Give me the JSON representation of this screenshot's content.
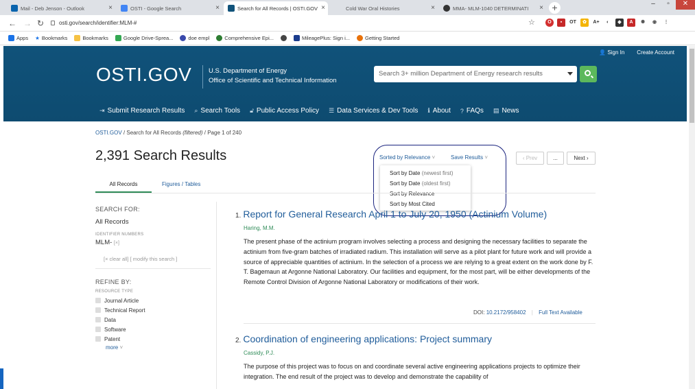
{
  "browser": {
    "tabs": [
      {
        "title": "Mail - Deb Jenson - Outlook",
        "color": "#0a64ad"
      },
      {
        "title": "OSTI - Google Search",
        "color": "#4285f4"
      },
      {
        "title": "Search for All Records | OSTI.GOV",
        "color": "#10527a"
      },
      {
        "title": "Cold War Oral Histories",
        "color": "#888888"
      },
      {
        "title": "MMA- MLM-1040 DETERMINATI",
        "color": "#333333"
      }
    ],
    "url": "osti.gov/search/identifier:MLM-#",
    "bookmarks": [
      "Apps",
      "Bookmarks",
      "Bookmarks",
      "Google Drive-Sprea...",
      "doe empl",
      "Comprehensive Epi...",
      "MileagePlus: Sign i...",
      "Getting Started"
    ]
  },
  "site": {
    "sign_in": "Sign In",
    "create_account": "Create Account",
    "logo": "OSTI.GOV",
    "doe_line1": "U.S. Department of Energy",
    "doe_line2": "Office of Scientific and Technical Information",
    "search_placeholder": "Search 3+ million Department of Energy research results",
    "nav": [
      "Submit Research Results",
      "Search Tools",
      "Public Access Policy",
      "Data Services & Dev Tools",
      "About",
      "FAQs",
      "News"
    ]
  },
  "page": {
    "crumb_home": "OSTI.GOV",
    "crumb_search": "Search for All Records",
    "crumb_filtered": "(filtered)",
    "crumb_page": "Page 1 of 240",
    "results_count": "2,391 Search Results",
    "sorted_by": "Sorted by Relevance",
    "save_results": "Save Results",
    "sort_options": [
      {
        "main": "Sort by Date",
        "sub": "(newest first)"
      },
      {
        "main": "Sort by Date",
        "sub": "(oldest first)"
      },
      {
        "main": "Sort by Relevance",
        "sub": ""
      },
      {
        "main": "Sort by Most Cited",
        "sub": ""
      }
    ],
    "pager": {
      "prev": "‹ Prev",
      "ellipsis": "...",
      "next": "Next ›"
    },
    "tabs": [
      "All Records",
      "Figures / Tables"
    ]
  },
  "sidebar": {
    "search_for": "SEARCH FOR:",
    "all_records": "All Records",
    "identifier_label": "IDENTIFIER NUMBERS",
    "identifier_value": "MLM-",
    "identifier_remove": "[×]",
    "clear_all": "[× clear all]",
    "modify_search": "[ modify this search ]",
    "refine_by": "REFINE BY:",
    "resource_type": "RESOURCE TYPE",
    "resource_types": [
      "Journal Article",
      "Technical Report",
      "Data",
      "Software",
      "Patent"
    ],
    "more": "more"
  },
  "results": [
    {
      "num": "1.",
      "title": "Report for General Research April 1 to July 20, 1950 (Actinium Volume)",
      "author": "Haring, M.M.",
      "abstract": "The present phase of the actinium program involves selecting a process and designing the necessary facilities to separate the actinium from five-gram batches of irradiated radium. This installation will serve as a pilot plant for future work and will provide a source of appreciable quantities of actinium. In the selection of a process we are relying to a great extent on the work done by F. T. Bagemaun at Argonne National Laboratory. Our facilities and equipment, for the most part, will be either developments of the Remote Control Division of Argonne National Laboratory or modifications of their work.",
      "doi_label": "DOI:",
      "doi": "10.2172/958402",
      "full_text": "Full Text Available"
    },
    {
      "num": "2.",
      "title": "Coordination of engineering applications: Project summary",
      "author": "Cassidy, P.J.",
      "abstract": "The purpose of this project was to focus on and coordinate several active engineering applications projects to optimize their integration. The end result of the project was to develop and demonstrate the capability of"
    }
  ]
}
